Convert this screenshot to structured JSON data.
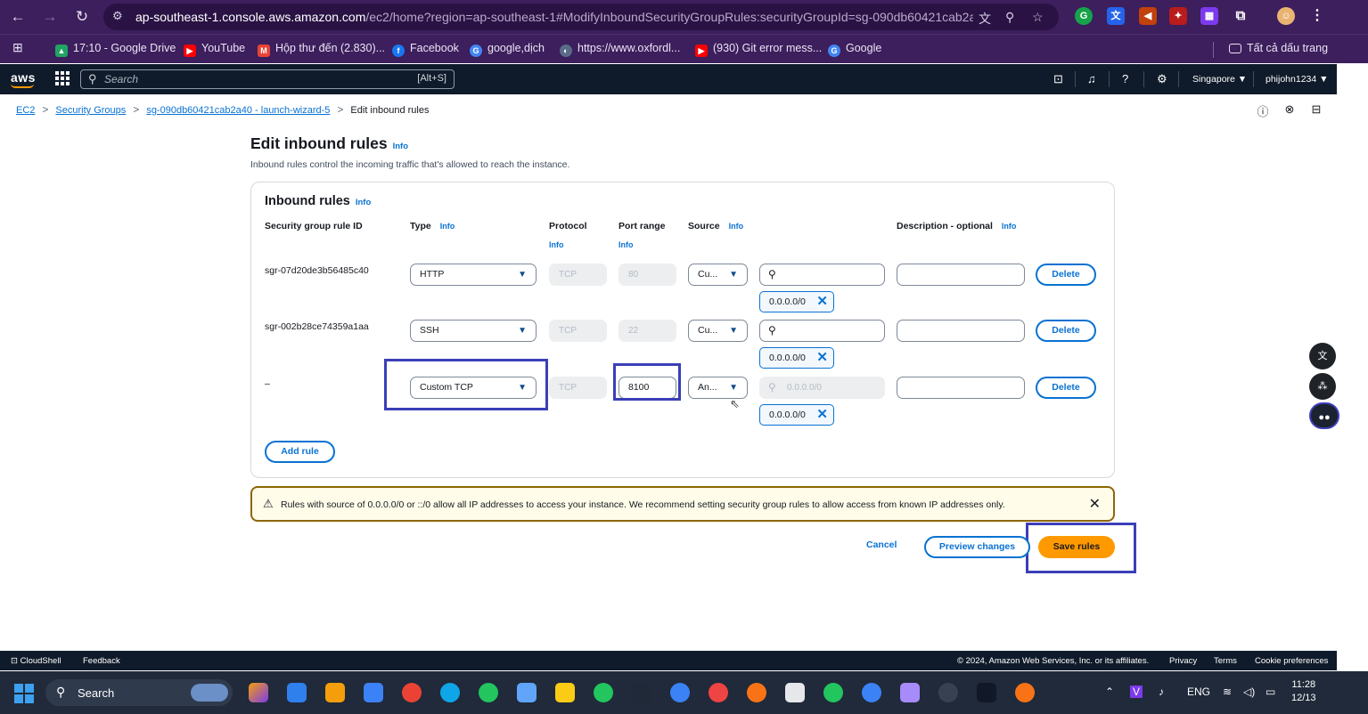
{
  "browser": {
    "url_host": "ap-southeast-1.console.aws.amazon.com",
    "url_rest": "/ec2/home?region=ap-southeast-1#ModifyInboundSecurityGroupRules:securityGroupId=sg-090db60421cab2a...",
    "bookmarks": [
      {
        "label": "17:10 - Google Drive",
        "color": "#1fa463",
        "icon": "drive-icon"
      },
      {
        "label": "YouTube",
        "color": "#ff0000",
        "icon": "youtube-icon"
      },
      {
        "label": "Hộp thư đến (2.830)...",
        "color": "#ea4335",
        "icon": "gmail-icon"
      },
      {
        "label": "Facebook",
        "color": "#1877f2",
        "icon": "facebook-icon"
      },
      {
        "label": "google,dịch",
        "color": "#4285f4",
        "icon": "google-icon"
      },
      {
        "label": "https://www.oxfordl...",
        "color": "#5a6b8a",
        "icon": "oxford-icon"
      },
      {
        "label": "(930) Git error mess...",
        "color": "#ff0000",
        "icon": "youtube-icon"
      },
      {
        "label": "Google",
        "color": "#4285f4",
        "icon": "google-icon"
      }
    ],
    "all_bookmarks": "Tất cả dấu trang"
  },
  "aws_nav": {
    "logo": "aws",
    "search_placeholder": "Search",
    "search_shortcut": "[Alt+S]",
    "region": "Singapore ▼",
    "account": "phijohn1234 ▼"
  },
  "breadcrumb": {
    "items": [
      "EC2",
      "Security Groups",
      "sg-090db60421cab2a40 - launch-wizard-5"
    ],
    "current": "Edit inbound rules"
  },
  "page": {
    "title": "Edit inbound rules",
    "info": "Info",
    "description": "Inbound rules control the incoming traffic that's allowed to reach the instance."
  },
  "panel": {
    "title": "Inbound rules",
    "info": "Info",
    "columns": {
      "rule_id": "Security group rule ID",
      "type": "Type",
      "protocol": "Protocol",
      "port_range": "Port range",
      "source": "Source",
      "description": "Description - optional"
    },
    "rules": [
      {
        "id": "sgr-07d20de3b56485c40",
        "type": "HTTP",
        "protocol": "TCP",
        "port": "80",
        "source": "Cu...",
        "search": "",
        "cidr": "0.0.0.0/0",
        "description": "",
        "delete": "Delete"
      },
      {
        "id": "sgr-002b28ce74359a1aa",
        "type": "SSH",
        "protocol": "TCP",
        "port": "22",
        "source": "Cu...",
        "search": "",
        "cidr": "0.0.0.0/0",
        "description": "",
        "delete": "Delete"
      },
      {
        "id": "–",
        "type": "Custom TCP",
        "protocol": "TCP",
        "port": "8100",
        "source": "An...",
        "search": "0.0.0.0/0",
        "cidr": "0.0.0.0/0",
        "description": "",
        "delete": "Delete"
      }
    ],
    "add_rule": "Add rule"
  },
  "warning": {
    "text": "Rules with source of 0.0.0.0/0 or ::/0 allow all IP addresses to access your instance. We recommend setting security group rules to allow access from known IP addresses only."
  },
  "actions": {
    "cancel": "Cancel",
    "preview": "Preview changes",
    "save": "Save rules"
  },
  "footer": {
    "cloudshell": "CloudShell",
    "feedback": "Feedback",
    "copyright": "© 2024, Amazon Web Services, Inc. or its affiliates.",
    "privacy": "Privacy",
    "terms": "Terms",
    "cookies": "Cookie preferences"
  },
  "taskbar": {
    "search": "Search",
    "lang": "ENG",
    "time": "11:28",
    "date": "12/13"
  },
  "colors": {
    "accent": "#0972d3",
    "primary_button": "#ff9900",
    "highlight": "#3b3fb8"
  }
}
